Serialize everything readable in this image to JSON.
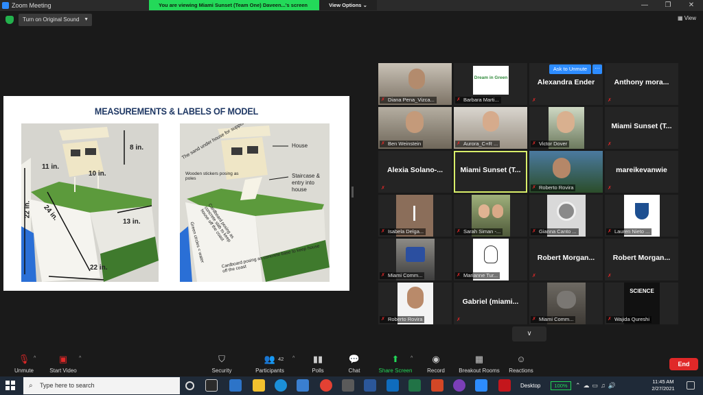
{
  "window": {
    "title": "Zoom Meeting"
  },
  "banner": {
    "viewing": "You are viewing Miami Sunset (Team One) Daveen...'s screen",
    "view_options": "View Options"
  },
  "topbar": {
    "audio_button": "Turn on Original Sound",
    "view_button": "View"
  },
  "slide": {
    "title": "MEASUREMENTS & LABELS OF MODEL",
    "left_labels": [
      "8 in.",
      "11 in.",
      "10 in.",
      "22 in.",
      "24 in.",
      "13 in.",
      "22 in."
    ],
    "right_labels": [
      "The sand under house for support and stability",
      "House",
      "Staircase & entry into house",
      "Wooden stickers posing as poles",
      "Cardboard posing as concrete slab to keep house off the coast",
      "Green circles = water",
      "Cardboard posing as concrete base to keep house off the coast"
    ]
  },
  "gallery": {
    "ask_unmute": "Ask to Unmute",
    "more": "···",
    "tiles": [
      {
        "name": "Diana Pena_Vizca..."
      },
      {
        "name": "Barbara Marti..."
      },
      {
        "name": "Alexandra Ender"
      },
      {
        "name": "Anthony mora..."
      },
      {
        "name": "Ben Weinstein"
      },
      {
        "name": "Aurora_C+R ..."
      },
      {
        "name": "Victor Dover"
      },
      {
        "name": "Miami Sunset (T..."
      },
      {
        "name": "Alexia Solano-..."
      },
      {
        "name": "Miami Sunset (T..."
      },
      {
        "name": "Roberto Rovira"
      },
      {
        "name": "mareikevanwie"
      },
      {
        "name": "Isabela Delga..."
      },
      {
        "name": "Sarah Siman -..."
      },
      {
        "name": "Gianna Canto ..."
      },
      {
        "name": "Lauren Nieto ..."
      },
      {
        "name": "Miami Comm..."
      },
      {
        "name": "Marianne Tur..."
      },
      {
        "name": "Robert Morgan..."
      },
      {
        "name": "Robert Morgan..."
      },
      {
        "name": "Roberto Rovira"
      },
      {
        "name": "Gabriel (miami..."
      },
      {
        "name": "Miami Comm..."
      },
      {
        "name": "Wajida Qureshi"
      }
    ],
    "logo_text": "Dream in Green",
    "science_text": "SCIENCE",
    "next_page": "∨"
  },
  "controls": {
    "unmute": "Unmute",
    "start_video": "Start Video",
    "security": "Security",
    "participants": "Participants",
    "participants_count": "42",
    "polls": "Polls",
    "chat": "Chat",
    "share_screen": "Share Screen",
    "record": "Record",
    "breakout_rooms": "Breakout Rooms",
    "reactions": "Reactions",
    "end": "End"
  },
  "taskbar": {
    "search_placeholder": "Type here to search",
    "desktop": "Desktop",
    "battery": "100%",
    "time": "11:45 AM",
    "date": "2/27/2021"
  }
}
